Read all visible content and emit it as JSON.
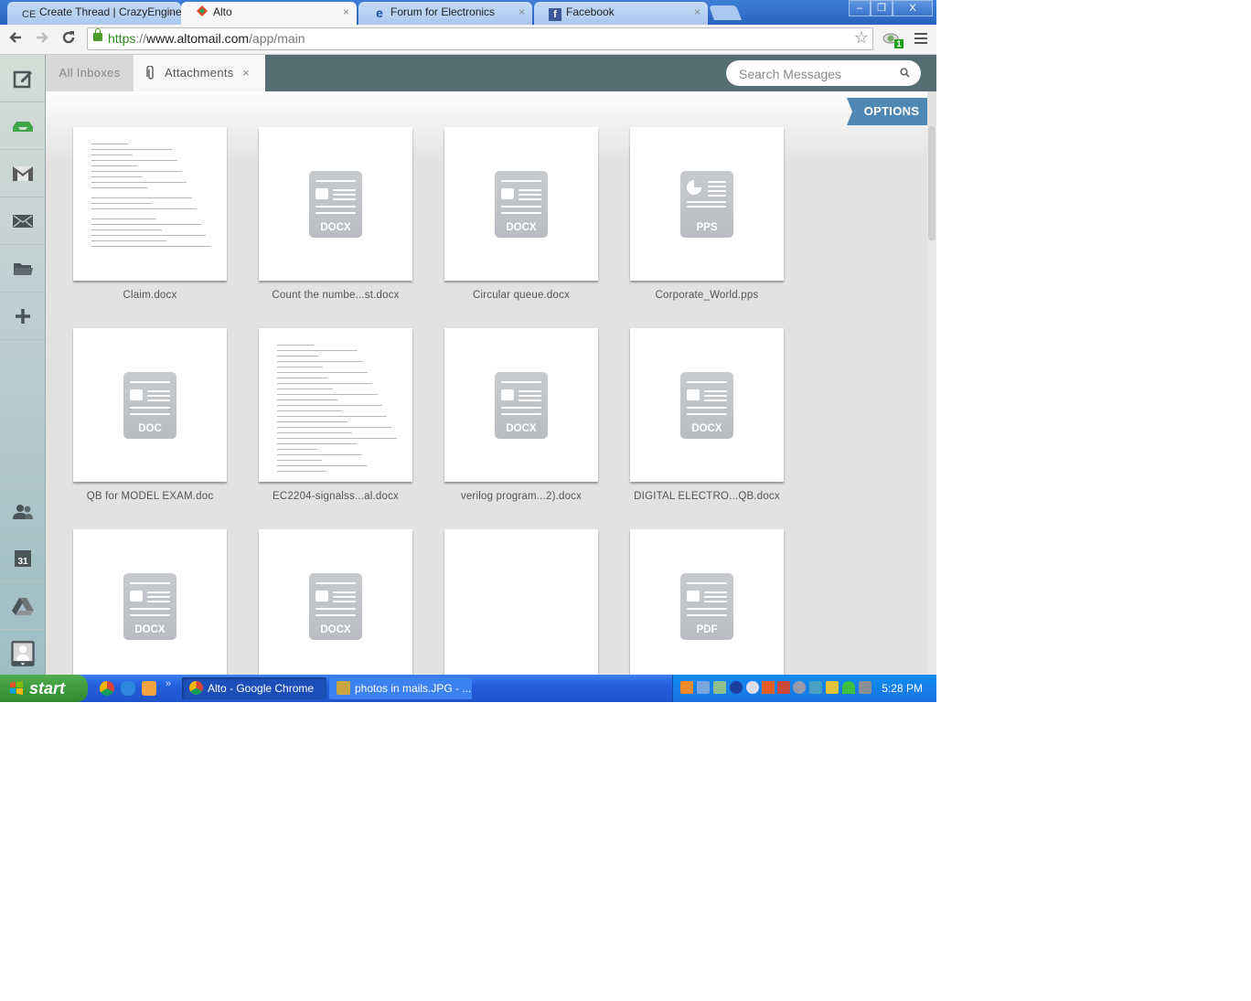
{
  "browser": {
    "tabs": [
      {
        "title": "Create Thread | CrazyEngineers",
        "favicon": "CE",
        "active": false
      },
      {
        "title": "Alto",
        "favicon": "alto-logo",
        "active": true
      },
      {
        "title": "Forum for Electronics",
        "favicon": "ie-e",
        "active": false
      },
      {
        "title": "Facebook",
        "favicon": "f",
        "active": false
      }
    ],
    "url": {
      "scheme": "https",
      "sep": "://",
      "host": "www.altomail.com",
      "path": "/app/main"
    },
    "extension_badge": "1",
    "window_controls": {
      "minimize": "–",
      "restore": "❐",
      "close": "X"
    }
  },
  "app": {
    "sidebar": [
      {
        "name": "compose",
        "icon": "compose-icon"
      },
      {
        "name": "inbox",
        "icon": "inbox-tray-icon"
      },
      {
        "name": "gmail",
        "icon": "gmail-icon"
      },
      {
        "name": "mail",
        "icon": "envelope-icon"
      },
      {
        "name": "folders",
        "icon": "folder-icon"
      },
      {
        "name": "add",
        "icon": "plus-icon"
      },
      {
        "name": "contacts",
        "icon": "people-icon"
      },
      {
        "name": "calendar",
        "icon": "calendar-icon",
        "label": "31"
      },
      {
        "name": "drive",
        "icon": "google-drive-icon"
      },
      {
        "name": "account",
        "icon": "avatar-icon"
      }
    ],
    "tabs": {
      "all_inboxes": "All Inboxes",
      "attachments": "Attachments",
      "close": "×"
    },
    "search": {
      "placeholder": "Search Messages"
    },
    "options_label": "OPTIONS",
    "attachments": [
      {
        "name": "Claim.docx",
        "type": "preview"
      },
      {
        "name": "Count the numbe...st.docx",
        "type": "DOCX"
      },
      {
        "name": "Circular queue.docx",
        "type": "DOCX"
      },
      {
        "name": "Corporate_World.pps",
        "type": "PPS"
      },
      {
        "name": "QB for MODEL EXAM.doc",
        "type": "DOC"
      },
      {
        "name": "EC2204-signalss...al.docx",
        "type": "preview"
      },
      {
        "name": "verilog program...2).docx",
        "type": "DOCX"
      },
      {
        "name": "DIGITAL ELECTRO...QB.docx",
        "type": "DOCX"
      },
      {
        "name": "",
        "type": "DOCX"
      },
      {
        "name": "",
        "type": "DOCX"
      },
      {
        "name": "",
        "type": "blank"
      },
      {
        "name": "",
        "type": "PDF"
      }
    ]
  },
  "taskbar": {
    "start_label": "start",
    "tasks": [
      {
        "label": "Alto - Google Chrome",
        "active": true
      },
      {
        "label": "photos in mails.JPG - ...",
        "active": false
      }
    ],
    "overflow": "»",
    "clock": "5:28 PM"
  }
}
